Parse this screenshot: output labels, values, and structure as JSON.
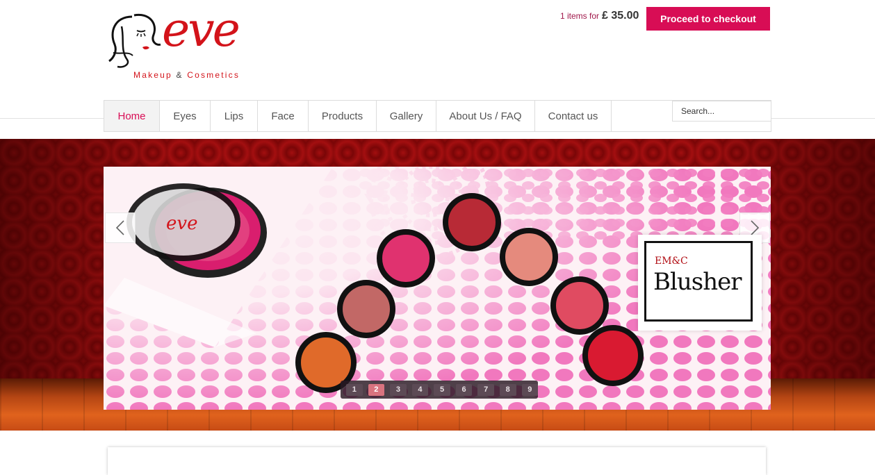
{
  "header": {
    "logo": {
      "name": "eve",
      "tagline_a": "Makeup",
      "tagline_amp": "&",
      "tagline_b": "Cosmetics"
    },
    "cart": {
      "count_text": "1 items for",
      "total": "£ 35.00"
    },
    "checkout_label": "Proceed to checkout"
  },
  "nav": {
    "items": [
      {
        "label": "Home",
        "active": true
      },
      {
        "label": "Eyes"
      },
      {
        "label": "Lips"
      },
      {
        "label": "Face"
      },
      {
        "label": "Products"
      },
      {
        "label": "Gallery"
      },
      {
        "label": "About Us / FAQ"
      },
      {
        "label": "Contact us"
      }
    ],
    "search_placeholder": "Search..."
  },
  "slider": {
    "prev_icon": "chevron-left-icon",
    "next_icon": "chevron-right-icon",
    "card": {
      "brand": "EM&C",
      "title": "Blusher"
    },
    "product_lid_text": "eve",
    "pages": [
      "1",
      "2",
      "3",
      "4",
      "5",
      "6",
      "7",
      "8",
      "9"
    ],
    "active_page": "2"
  },
  "colors": {
    "accent": "#d80d55",
    "brand_red": "#d3131a",
    "hero_red": "#8f0b0c"
  }
}
